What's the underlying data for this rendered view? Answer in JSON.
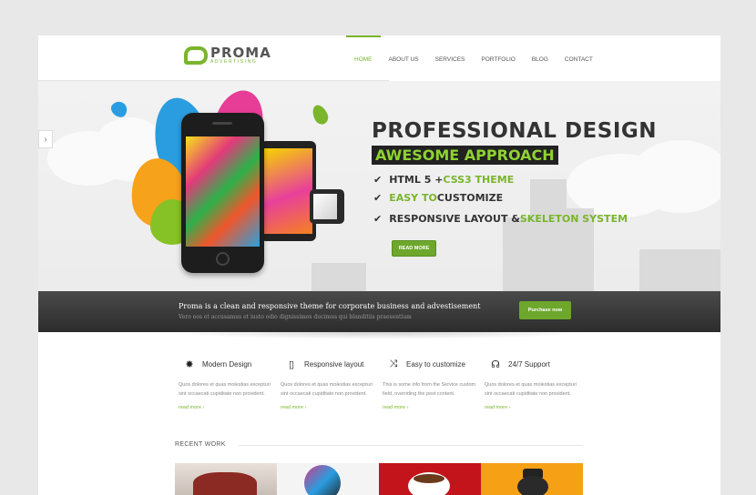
{
  "logo": {
    "name": "PROMA",
    "tagline": "ADVERTISING"
  },
  "nav": [
    "HOME",
    "ABOUT US",
    "SERVICES",
    "PORTFOLIO",
    "BLOG",
    "CONTACT"
  ],
  "hero": {
    "title": "PROFESSIONAL DESIGN",
    "subtitle": "AWESOME APPROACH",
    "features": [
      {
        "a": "HTML 5 + ",
        "b": "CSS3 THEME",
        "c": ""
      },
      {
        "a": "",
        "b": "EASY TO",
        "c": " CUSTOMIZE"
      },
      {
        "a": "RESPONSIVE LAYOUT & ",
        "b": "SKELETON SYSTEM",
        "c": ""
      }
    ],
    "button": "READ MORE",
    "arrow": "›"
  },
  "promo": {
    "title": "Proma is a clean and responsive theme for corporate business and advestisement",
    "subtitle": "Vero eos et accusamus et iusto odio dignissimos ducimus qui blanditiis praesentium",
    "button": "Purchase now"
  },
  "features": [
    {
      "icon": "gear-icon",
      "glyph": "✸",
      "title": "Modern Design",
      "text": "Quos dolores et quas molestias excepturi sint occaecati cupiditate non provident.",
      "more": "read more ›"
    },
    {
      "icon": "mobile-icon",
      "glyph": "▯",
      "title": "Responsive layout",
      "text": "Quos dolores et quas molestias excepturi sint occaecati cupiditate non provident.",
      "more": "read more ›"
    },
    {
      "icon": "shuffle-icon",
      "glyph": "⤨",
      "title": "Easy to customize",
      "text": "This is some info from the Service custom field, overriding the post content.",
      "more": "read more ›"
    },
    {
      "icon": "headphones-icon",
      "glyph": "☊",
      "title": "24/7 Support",
      "text": "Quos dolores et quas molestias excepturi sint occaecati cupiditate non provident.",
      "more": "read more ›"
    }
  ],
  "recent": {
    "title": "RECENT WORK"
  },
  "colors": {
    "accent": "#7ab52c",
    "dark": "#2c2c2c"
  }
}
